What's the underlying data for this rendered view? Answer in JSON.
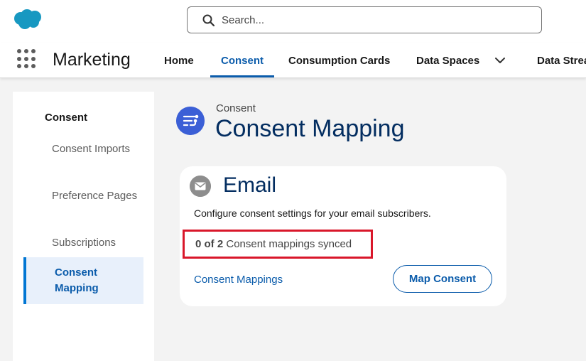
{
  "header": {
    "logo_icon": "salesforce-cloud-icon",
    "search": {
      "placeholder": "Search..."
    }
  },
  "nav": {
    "app_name": "Marketing",
    "tabs": [
      {
        "label": "Home"
      },
      {
        "label": "Consent",
        "active": true
      },
      {
        "label": "Consumption Cards"
      },
      {
        "label": "Data Spaces"
      },
      {
        "label": "Data Strea"
      }
    ],
    "more_icon": "chevron-down-icon"
  },
  "sidebar": {
    "heading": "Consent",
    "items": [
      {
        "label": "Consent Imports"
      },
      {
        "label": "Preference Pages"
      },
      {
        "label": "Subscriptions"
      },
      {
        "label": "Consent Mapping",
        "active": true
      }
    ]
  },
  "page": {
    "eyebrow": "Consent",
    "title": "Consent Mapping",
    "icon": "consent-mapping-icon"
  },
  "card": {
    "title": "Email",
    "icon": "envelope-icon",
    "description": "Configure consent settings for your email subscribers.",
    "sync_count": "0 of 2",
    "sync_suffix": "Consent mappings synced",
    "link_label": "Consent Mappings",
    "button_label": "Map Consent"
  },
  "colors": {
    "brand_blue": "#0b5cab",
    "highlight_red": "#d9172a",
    "title_navy": "#032d60"
  }
}
